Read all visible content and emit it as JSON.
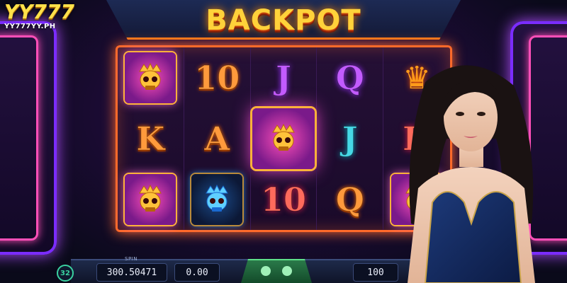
{
  "logo": {
    "main": "YY777",
    "sub": "YY777YY.PH"
  },
  "game": {
    "title": "BACKPOT"
  },
  "reels": [
    [
      {
        "kind": "tile",
        "style": "gold"
      },
      {
        "kind": "text",
        "text": "10",
        "color": "orange"
      },
      {
        "kind": "text",
        "text": "J",
        "color": "violet"
      },
      {
        "kind": "text",
        "text": "Q",
        "color": "violet"
      },
      {
        "kind": "crown"
      }
    ],
    [
      {
        "kind": "text",
        "text": "K",
        "color": "orange"
      },
      {
        "kind": "text",
        "text": "A",
        "color": "orange"
      },
      {
        "kind": "tile",
        "style": "gold-big"
      },
      {
        "kind": "text",
        "text": "J",
        "color": "teal"
      },
      {
        "kind": "text",
        "text": "K",
        "color": "red"
      }
    ],
    [
      {
        "kind": "tile",
        "style": "gold"
      },
      {
        "kind": "tile",
        "style": "blue"
      },
      {
        "kind": "text",
        "text": "10",
        "color": "red"
      },
      {
        "kind": "text",
        "text": "Q",
        "color": "orange"
      },
      {
        "kind": "tile",
        "style": "gold"
      }
    ]
  ],
  "controls": {
    "round_button": "32",
    "spin_label": "SPIN",
    "balance": "300.50471",
    "win": "0.00",
    "bet": "100"
  },
  "colors": {
    "frame_orange": "#ff6a2a",
    "neon_purple": "#7b2cff",
    "title_gold": "#ffd23a"
  },
  "icons": [
    "skull-tile-icon",
    "crown-icon",
    "model-figure"
  ]
}
